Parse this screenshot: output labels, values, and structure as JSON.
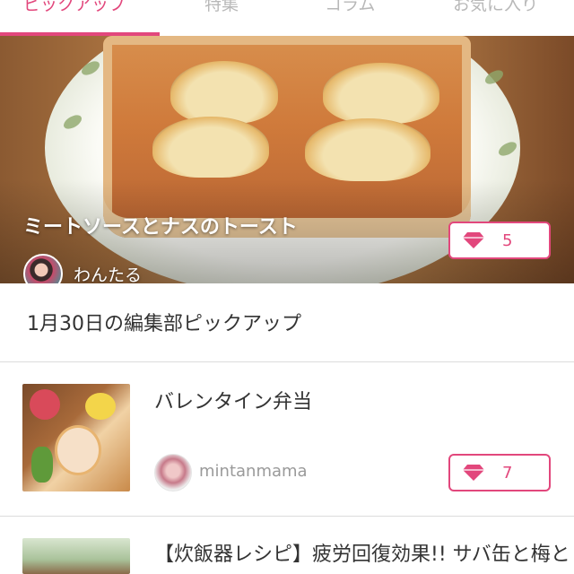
{
  "tabs": [
    {
      "label": "ピックアップ",
      "active": true
    },
    {
      "label": "特集",
      "active": false
    },
    {
      "label": "コラム",
      "active": false
    },
    {
      "label": "お気に入り",
      "active": false
    }
  ],
  "hero": {
    "title": "ミートソースとナスのトースト",
    "author": "わんたる",
    "like_count": "5"
  },
  "section": {
    "title": "1月30日の編集部ピックアップ"
  },
  "items": [
    {
      "title": "バレンタイン弁当",
      "author": "mintanmama",
      "like_count": "7"
    },
    {
      "title": "【炊飯器レシピ】疲労回復効果!! サバ缶と梅と"
    }
  ],
  "colors": {
    "accent": "#e2477c",
    "divider": "#dcdcdc",
    "inactive_tab": "#b8b8b8"
  },
  "icons": {
    "like": "gem-icon"
  }
}
